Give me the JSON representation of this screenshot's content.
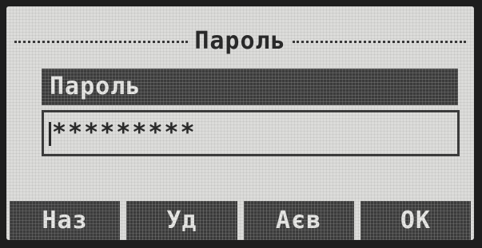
{
  "screen": {
    "title": "Пароль"
  },
  "field": {
    "label": "Пароль",
    "value": "*********"
  },
  "softkeys": [
    {
      "label": "Наз"
    },
    {
      "label": "Уд"
    },
    {
      "label": "Аєв"
    },
    {
      "label": "ОК"
    }
  ]
}
